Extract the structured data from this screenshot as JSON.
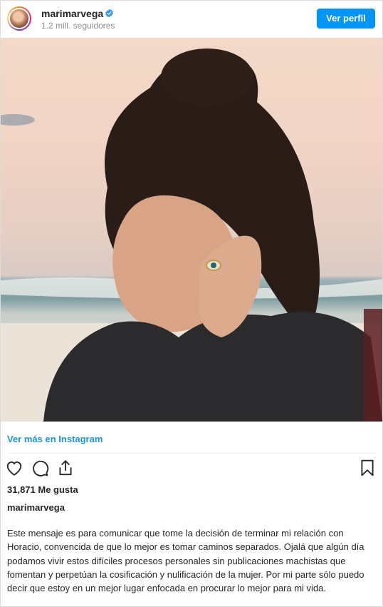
{
  "header": {
    "username": "marimarvega",
    "followers": "1.2 mill. seguidores",
    "view_profile_label": "Ver perfil"
  },
  "post": {
    "photo_alt": "",
    "more_link": "Ver más en Instagram",
    "likes": "31,871 Me gusta",
    "caption_user": "marimarvega",
    "caption": "Este mensaje es para comunicar que tome la decisión de terminar mi relación con Horacio, convencida de que lo mejor es tomar caminos separados. Ojalá que algún día podamos vivir estos difíciles procesos personales sin publicaciones machistas que fomentan y perpetúan la cosificación y nulificación de la mujer. Por mi parte sólo puedo decir que estoy en un mejor lugar enfocada en procurar lo mejor para mi vida."
  },
  "icons": {
    "like": "heart-icon",
    "comment": "comment-icon",
    "share": "share-icon",
    "save": "bookmark-icon",
    "verified": "verified-badge-icon"
  },
  "colors": {
    "button_blue": "#0095f6",
    "link_blue": "#1b95e0",
    "text": "#262626",
    "muted": "#8e8e8e"
  }
}
